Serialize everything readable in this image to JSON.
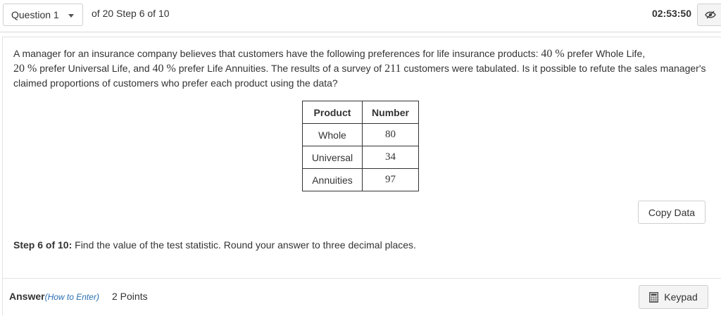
{
  "header": {
    "question_select": "Question 1",
    "progress": "of 20 Step 6 of 10",
    "timer": "02:53:50",
    "eye_icon": "eye-slash-icon"
  },
  "problem": {
    "text_1": "A manager for an insurance company believes that customers have the following preferences for life insurance products: ",
    "pct_whole": "40 %",
    "text_2": " prefer Whole Life,",
    "pct_universal": "20 %",
    "text_3": " prefer Universal Life, and ",
    "pct_annuities": "40 %",
    "text_4": " prefer Life Annuities. The results of a survey of ",
    "survey_count": "211",
    "text_5": " customers were tabulated. Is it possible to refute the sales manager's claimed proportions of customers who prefer each product using the data?"
  },
  "table": {
    "headers": [
      "Product",
      "Number"
    ],
    "rows": [
      [
        "Whole",
        "80"
      ],
      [
        "Universal",
        "34"
      ],
      [
        "Annuities",
        "97"
      ]
    ]
  },
  "copy_button": "Copy Data",
  "step": {
    "label": "Step 6 of 10:",
    "instruction": " Find the value of the test statistic. Round your answer to three decimal places."
  },
  "answer": {
    "label": "Answer",
    "how_to_enter": "(How to Enter)",
    "points": "2 Points",
    "keypad_label": "Keypad",
    "keypad_icon": "calculator-icon"
  }
}
